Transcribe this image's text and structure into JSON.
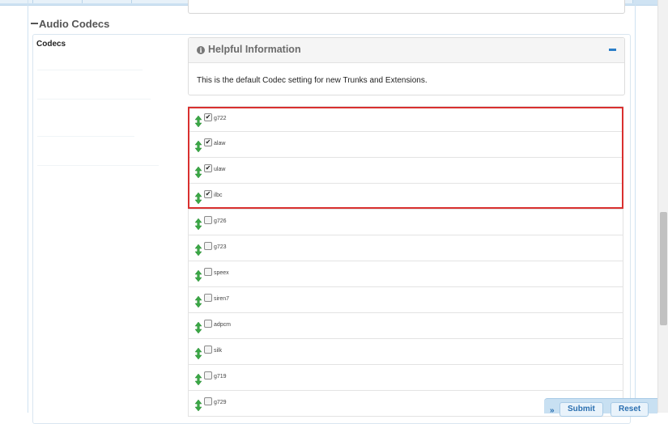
{
  "section": {
    "title": "Audio Codecs"
  },
  "field": {
    "label": "Codecs"
  },
  "help": {
    "title": "Helpful Information",
    "body": "This is the default Codec setting for new Trunks and Extensions."
  },
  "codecs": [
    {
      "name": "g722",
      "checked": true
    },
    {
      "name": "alaw",
      "checked": true
    },
    {
      "name": "ulaw",
      "checked": true
    },
    {
      "name": "ilbc",
      "checked": true
    },
    {
      "name": "g726",
      "checked": false
    },
    {
      "name": "g723",
      "checked": false
    },
    {
      "name": "speex",
      "checked": false
    },
    {
      "name": "siren7",
      "checked": false
    },
    {
      "name": "adpcm",
      "checked": false
    },
    {
      "name": "silk",
      "checked": false
    },
    {
      "name": "g719",
      "checked": false
    },
    {
      "name": "g729",
      "checked": false
    }
  ],
  "actions": {
    "submit": "Submit",
    "reset": "Reset",
    "chevron": "»"
  },
  "colors": {
    "highlight": "#d9302f",
    "accent": "#2a7ec8",
    "drag_icon": "#3aa845"
  }
}
